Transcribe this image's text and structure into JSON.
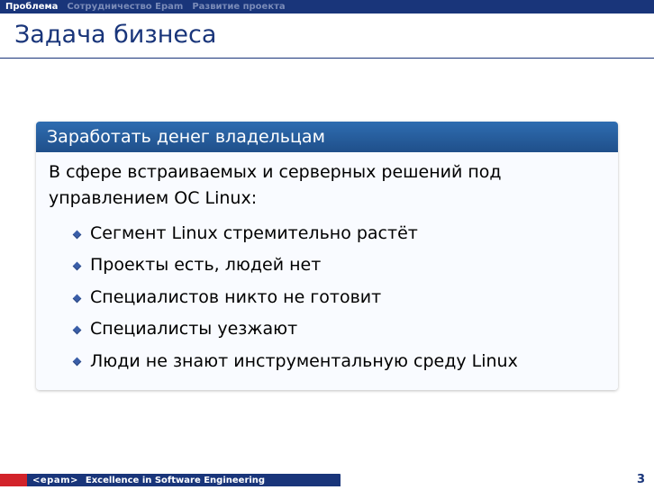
{
  "nav": {
    "sections": [
      {
        "label": "Проблема",
        "active": true
      },
      {
        "label": "Сотрудничество Epam",
        "active": false
      },
      {
        "label": "Развитие проекта",
        "active": false
      }
    ]
  },
  "title": "Задача бизнеса",
  "block": {
    "title": "Заработать денег владельцам",
    "intro": "В сфере встраиваемых и серверных решений под управлением ОС Linux:",
    "items": [
      "Сегмент Linux стремительно растёт",
      "Проекты есть, людей нет",
      "Специалистов никто не готовит",
      "Специалисты уезжают",
      "Люди не знают инструментальную среду Linux"
    ]
  },
  "footer": {
    "brand": "<epam>",
    "tagline": "Excellence in Software Engineering",
    "page": "3"
  }
}
